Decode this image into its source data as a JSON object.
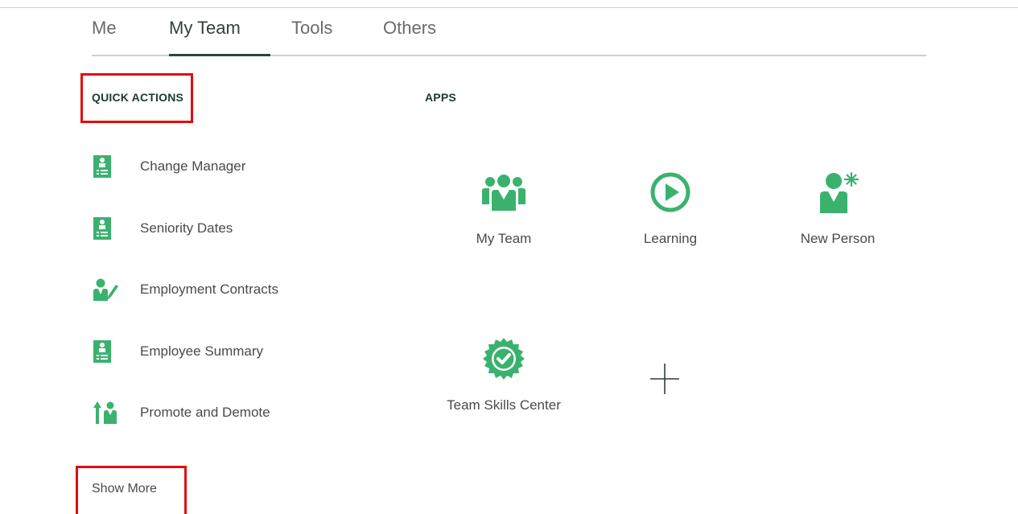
{
  "tabs": [
    {
      "label": "Me",
      "active": false
    },
    {
      "label": "My Team",
      "active": true
    },
    {
      "label": "Tools",
      "active": false
    },
    {
      "label": "Others",
      "active": false
    }
  ],
  "quick_actions": {
    "heading": "QUICK ACTIONS",
    "items": [
      {
        "label": "Change Manager",
        "icon": "id-badge-icon"
      },
      {
        "label": "Seniority Dates",
        "icon": "id-badge-icon"
      },
      {
        "label": "Employment Contracts",
        "icon": "person-pencil-icon"
      },
      {
        "label": "Employee Summary",
        "icon": "id-badge-icon"
      },
      {
        "label": "Promote and Demote",
        "icon": "person-up-arrow-icon"
      }
    ],
    "show_more_label": "Show More"
  },
  "apps": {
    "heading": "APPS",
    "items": [
      {
        "label": "My Team",
        "icon": "team-group-icon"
      },
      {
        "label": "Learning",
        "icon": "play-circle-icon"
      },
      {
        "label": "New Person",
        "icon": "person-asterisk-icon"
      },
      {
        "label": "Team Skills Center",
        "icon": "badge-check-icon"
      }
    ],
    "add_icon": "plus-icon"
  },
  "colors": {
    "accent_green": "#3ab26e",
    "dark_green": "#24483a",
    "highlight_red": "#e20d0d"
  }
}
